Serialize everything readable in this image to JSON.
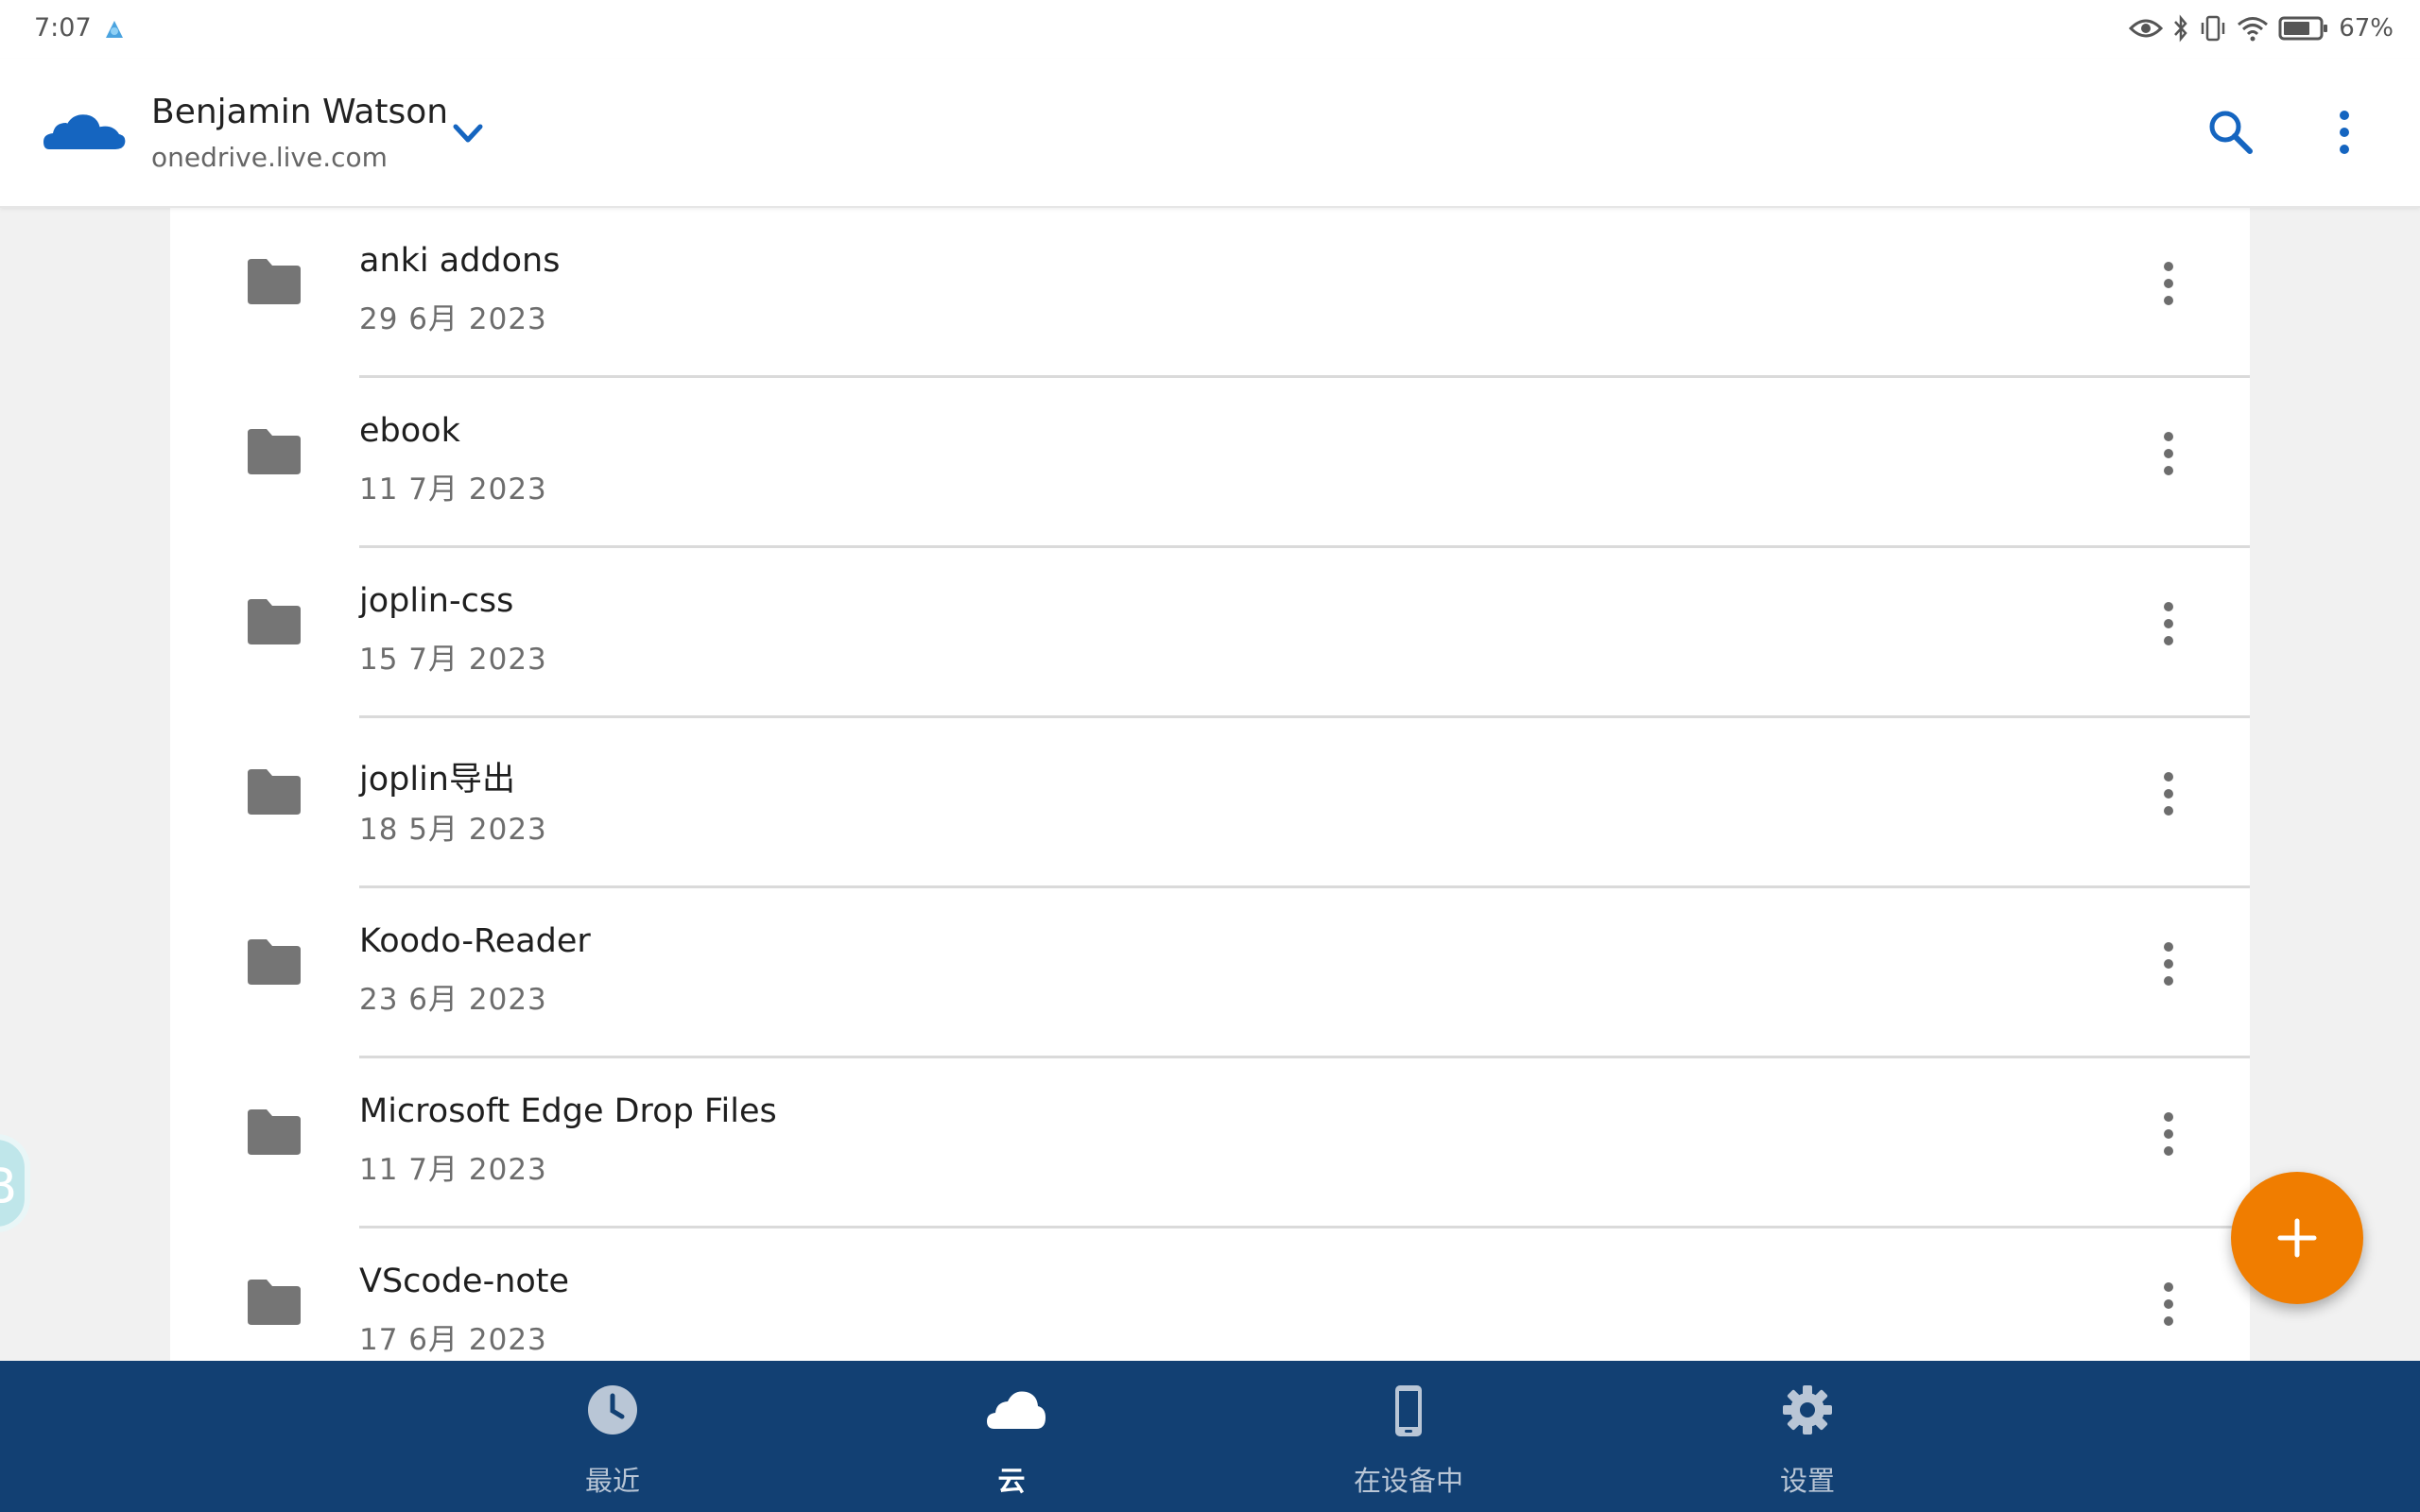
{
  "status_bar": {
    "time": "7:07",
    "battery": "67%",
    "icons": [
      "eye-icon",
      "bluetooth-icon",
      "vibrate-icon",
      "wifi-icon",
      "battery-icon"
    ]
  },
  "header": {
    "account_name": "Benjamin Watson",
    "account_domain": "onedrive.live.com",
    "brand_color": "#1565c0"
  },
  "files": [
    {
      "name": "anki addons",
      "date": "29 6月 2023"
    },
    {
      "name": "ebook",
      "date": "11 7月 2023"
    },
    {
      "name": "joplin-css",
      "date": "15 7月 2023"
    },
    {
      "name": "joplin导出",
      "date": "18 5月 2023"
    },
    {
      "name": "Koodo-Reader",
      "date": "23 6月 2023"
    },
    {
      "name": "Microsoft Edge Drop Files",
      "date": "11 7月 2023"
    },
    {
      "name": "VScode-note",
      "date": "17 6月 2023"
    }
  ],
  "floating": {
    "side_bubble_letter": "B",
    "fab_color": "#f07d00"
  },
  "bottom_nav": {
    "background": "#124073",
    "items": [
      {
        "label": "最近",
        "icon": "clock-icon",
        "active": false
      },
      {
        "label": "云",
        "icon": "cloud-icon",
        "active": true
      },
      {
        "label": "在设备中",
        "icon": "phone-icon",
        "active": false
      },
      {
        "label": "设置",
        "icon": "gear-icon",
        "active": false
      }
    ]
  }
}
